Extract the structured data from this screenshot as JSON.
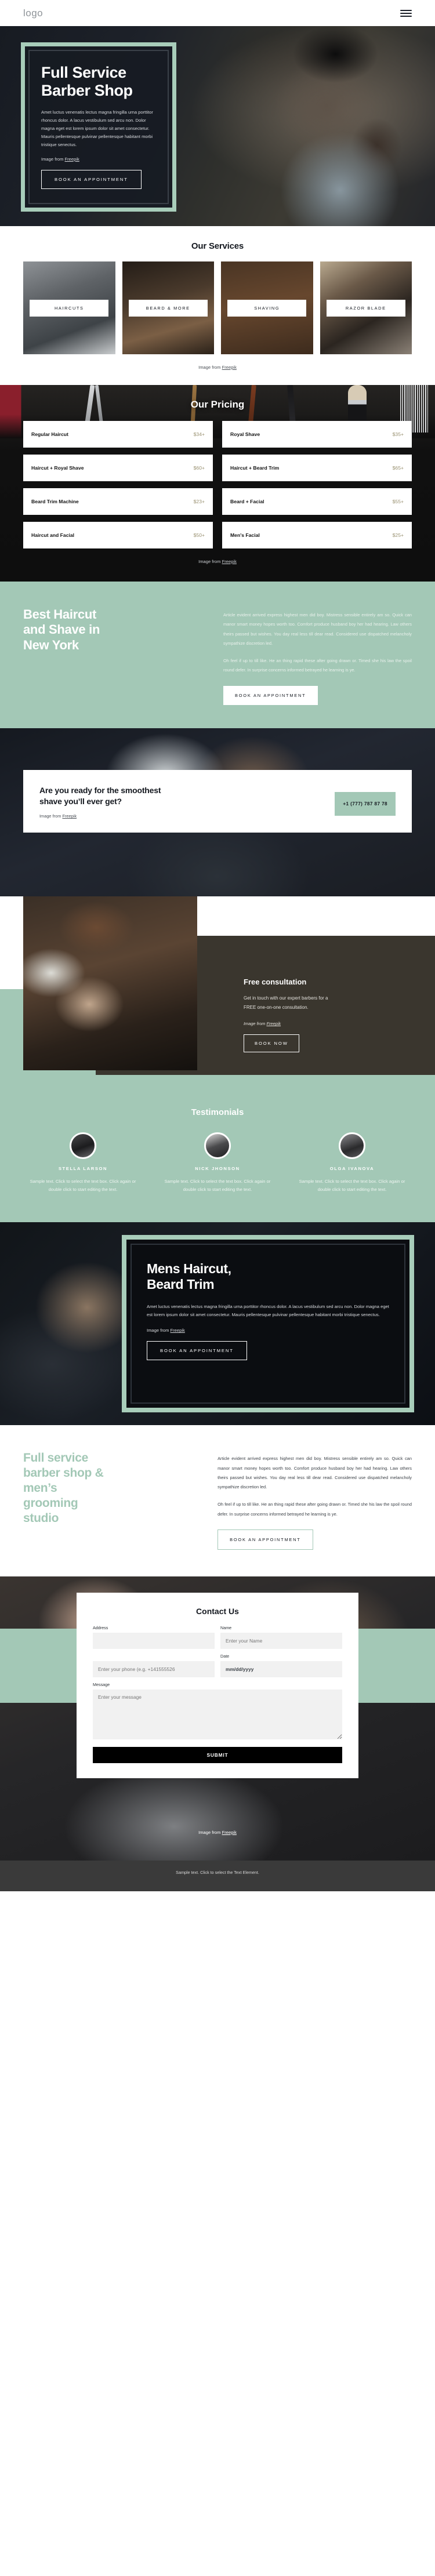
{
  "header": {
    "logo": "logo",
    "menu_icon": "hamburger-menu-icon"
  },
  "hero": {
    "title_line1": "Full Service",
    "title_line2": "Barber Shop",
    "paragraph": "Amet luctus venenatis lectus magna fringilla urna porttitor rhoncus dolor. A lacus vestibulum sed arcu non. Dolor magna eget est lorem ipsum dolor sit amet consectetur. Mauris pellentesque pulvinar pellentesque habitant morbi tristique senectus.",
    "credit_prefix": "Image from ",
    "credit_link": "Freepik",
    "cta": "BOOK AN APPOINTMENT"
  },
  "services": {
    "title": "Our Services",
    "cards": [
      {
        "label": "HAIRCUTS"
      },
      {
        "label": "BEARD & MORE"
      },
      {
        "label": "SHAVING"
      },
      {
        "label": "RAZOR BLADE"
      }
    ],
    "credit_prefix": "Image from ",
    "credit_link": "Freepik"
  },
  "pricing": {
    "title": "Our Pricing",
    "items": [
      {
        "name": "Regular Haircut",
        "price": "$34+"
      },
      {
        "name": "Royal Shave",
        "price": "$35+"
      },
      {
        "name": "Haircut + Royal Shave",
        "price": "$60+"
      },
      {
        "name": "Haircut + Beard Trim",
        "price": "$65+"
      },
      {
        "name": "Beard Trim Machine",
        "price": "$23+"
      },
      {
        "name": "Beard + Facial",
        "price": "$55+"
      },
      {
        "name": "Haircut and Facial",
        "price": "$50+"
      },
      {
        "name": "Men's Facial",
        "price": "$25+"
      }
    ],
    "credit_prefix": "Image from ",
    "credit_link": "Freepik"
  },
  "best": {
    "title_line1": "Best Haircut",
    "title_line2": "and Shave in",
    "title_line3": "New York",
    "paragraph1": "Article evident arrived express highest men did boy. Mistress sensible entirely am so. Quick can manor smart money hopes worth too. Comfort produce husband boy her had hearing. Law others theirs passed but wishes. You day real less till dear read. Considered use dispatched melancholy sympathize discretion led.",
    "paragraph2": "Oh feel if up to till like. He an thing rapid these after going drawn or. Timed she his law the spoil round defer. In surprise concerns informed betrayed he learning is ye.",
    "cta": "BOOK AN APPOINTMENT"
  },
  "shave_cta": {
    "title_line1": "Are you ready for the smoothest",
    "title_line2": "shave you’ll ever get?",
    "credit_prefix": "Image from ",
    "credit_link": "Freepik",
    "phone": "+1 (777) 787 87 78"
  },
  "consultation": {
    "title": "Free consultation",
    "paragraph_line1": "Get in touch with our expert barbers for a",
    "paragraph_line2": "FREE one-on-one consultation.",
    "credit_prefix": "Image from ",
    "credit_link": "Freepik",
    "cta": "BOOK NOW"
  },
  "testimonials": {
    "title": "Testimonials",
    "items": [
      {
        "name": "STELLA LARSON",
        "text": "Sample text. Click to select the text box. Click again or double click to start editing the text."
      },
      {
        "name": "NICK JHONSON",
        "text": "Sample text. Click to select the text box. Click again or double click to start editing the text."
      },
      {
        "name": "OLGA IVANOVA",
        "text": "Sample text. Click to select the text box. Click again or double click to start editing the text."
      }
    ]
  },
  "mens": {
    "title_line1": "Mens Haircut,",
    "title_line2": "Beard Trim",
    "paragraph": "Amet luctus venenatis lectus magna fringilla urna porttitor rhoncus dolor. A lacus vestibulum sed arcu non. Dolor magna eget est lorem ipsum dolor sit amet consectetur. Mauris pellentesque pulvinar pellentesque habitant morbi tristique senectus.",
    "credit_prefix": "Image from ",
    "credit_link": "Freepik",
    "cta": "BOOK AN APPOINTMENT"
  },
  "fullservice": {
    "title_line1": "Full service",
    "title_line2": "barber shop &",
    "title_line3": "men’s",
    "title_line4": "grooming",
    "title_line5": "studio",
    "paragraph1": "Article evident arrived express highest men did boy. Mistress sensible entirely am so. Quick can manor smart money hopes worth too. Comfort produce husband boy her had hearing. Law others theirs passed but wishes. You day real less till dear read. Considered use dispatched melancholy sympathize discretion led.",
    "paragraph2": "Oh feel if up to till like. He an thing rapid these after going drawn or. Timed she his law the spoil round defer. In surprise concerns informed betrayed he learning is ye.",
    "cta": "BOOK AN APPOINTMENT"
  },
  "contact": {
    "title": "Contact Us",
    "address_label": "Address",
    "address_value": "",
    "name_label": "Name",
    "name_placeholder": "Enter your Name",
    "phone_placeholder": "Enter your phone (e.g. +141555526",
    "date_label": "Date",
    "date_value": "mm/dd/yyyy",
    "message_label": "Message",
    "message_placeholder": "Enter your message",
    "submit": "SUBMIT",
    "credit_prefix": "Image from ",
    "credit_link": "Freepik"
  },
  "footer": {
    "text": "Sample text. Click to select the Text Element."
  },
  "colors": {
    "accent_green": "#a3c8b6",
    "frame_green": "#a8cdba",
    "dark": "#14181f",
    "price_value": "#9b9373",
    "footer_bg": "#3a3a3a"
  }
}
